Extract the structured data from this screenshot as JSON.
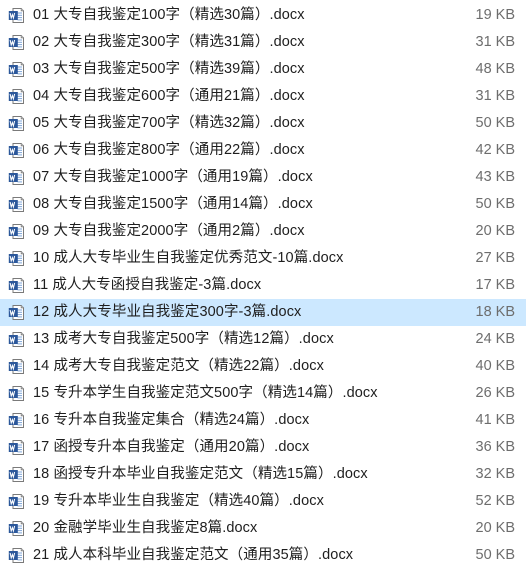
{
  "files": [
    {
      "name": "01 大专自我鉴定100字（精选30篇）.docx",
      "size": "19 KB",
      "icon": "word-doc-icon"
    },
    {
      "name": "02 大专自我鉴定300字（精选31篇）.docx",
      "size": "31 KB",
      "icon": "word-doc-icon"
    },
    {
      "name": "03 大专自我鉴定500字（精选39篇）.docx",
      "size": "48 KB",
      "icon": "word-doc-icon"
    },
    {
      "name": "04 大专自我鉴定600字（通用21篇）.docx",
      "size": "31 KB",
      "icon": "word-doc-icon"
    },
    {
      "name": "05 大专自我鉴定700字（精选32篇）.docx",
      "size": "50 KB",
      "icon": "word-doc-icon"
    },
    {
      "name": "06 大专自我鉴定800字（通用22篇）.docx",
      "size": "42 KB",
      "icon": "word-doc-icon"
    },
    {
      "name": "07 大专自我鉴定1000字（通用19篇）.docx",
      "size": "43 KB",
      "icon": "word-doc-icon"
    },
    {
      "name": "08 大专自我鉴定1500字（通用14篇）.docx",
      "size": "50 KB",
      "icon": "word-doc-icon"
    },
    {
      "name": "09 大专自我鉴定2000字（通用2篇）.docx",
      "size": "20 KB",
      "icon": "word-doc-icon"
    },
    {
      "name": "10 成人大专毕业生自我鉴定优秀范文-10篇.docx",
      "size": "27 KB",
      "icon": "word-doc-icon"
    },
    {
      "name": "11 成人大专函授自我鉴定-3篇.docx",
      "size": "17 KB",
      "icon": "word-doc-icon"
    },
    {
      "name": "12 成人大专毕业自我鉴定300字-3篇.docx",
      "size": "18 KB",
      "icon": "word-doc-icon"
    },
    {
      "name": "13 成考大专自我鉴定500字（精选12篇）.docx",
      "size": "24 KB",
      "icon": "word-doc-icon"
    },
    {
      "name": "14 成考大专自我鉴定范文（精选22篇）.docx",
      "size": "40 KB",
      "icon": "word-doc-icon"
    },
    {
      "name": "15 专升本学生自我鉴定范文500字（精选14篇）.docx",
      "size": "26 KB",
      "icon": "word-doc-icon"
    },
    {
      "name": "16 专升本自我鉴定集合（精选24篇）.docx",
      "size": "41 KB",
      "icon": "word-doc-icon"
    },
    {
      "name": "17 函授专升本自我鉴定（通用20篇）.docx",
      "size": "36 KB",
      "icon": "word-doc-icon"
    },
    {
      "name": "18 函授专升本毕业自我鉴定范文（精选15篇）.docx",
      "size": "32 KB",
      "icon": "word-doc-icon"
    },
    {
      "name": "19 专升本毕业生自我鉴定（精选40篇）.docx",
      "size": "52 KB",
      "icon": "word-doc-icon"
    },
    {
      "name": "20 金融学毕业生自我鉴定8篇.docx",
      "size": "20 KB",
      "icon": "word-doc-icon"
    },
    {
      "name": "21 成人本科毕业自我鉴定范文（通用35篇）.docx",
      "size": "50 KB",
      "icon": "word-doc-icon"
    }
  ],
  "highlighted_index": 11,
  "colors": {
    "row_highlight": "#cce8ff",
    "word_blue": "#2b579a",
    "name_text": "#1e1e1e",
    "size_text": "#6d6d6d"
  }
}
